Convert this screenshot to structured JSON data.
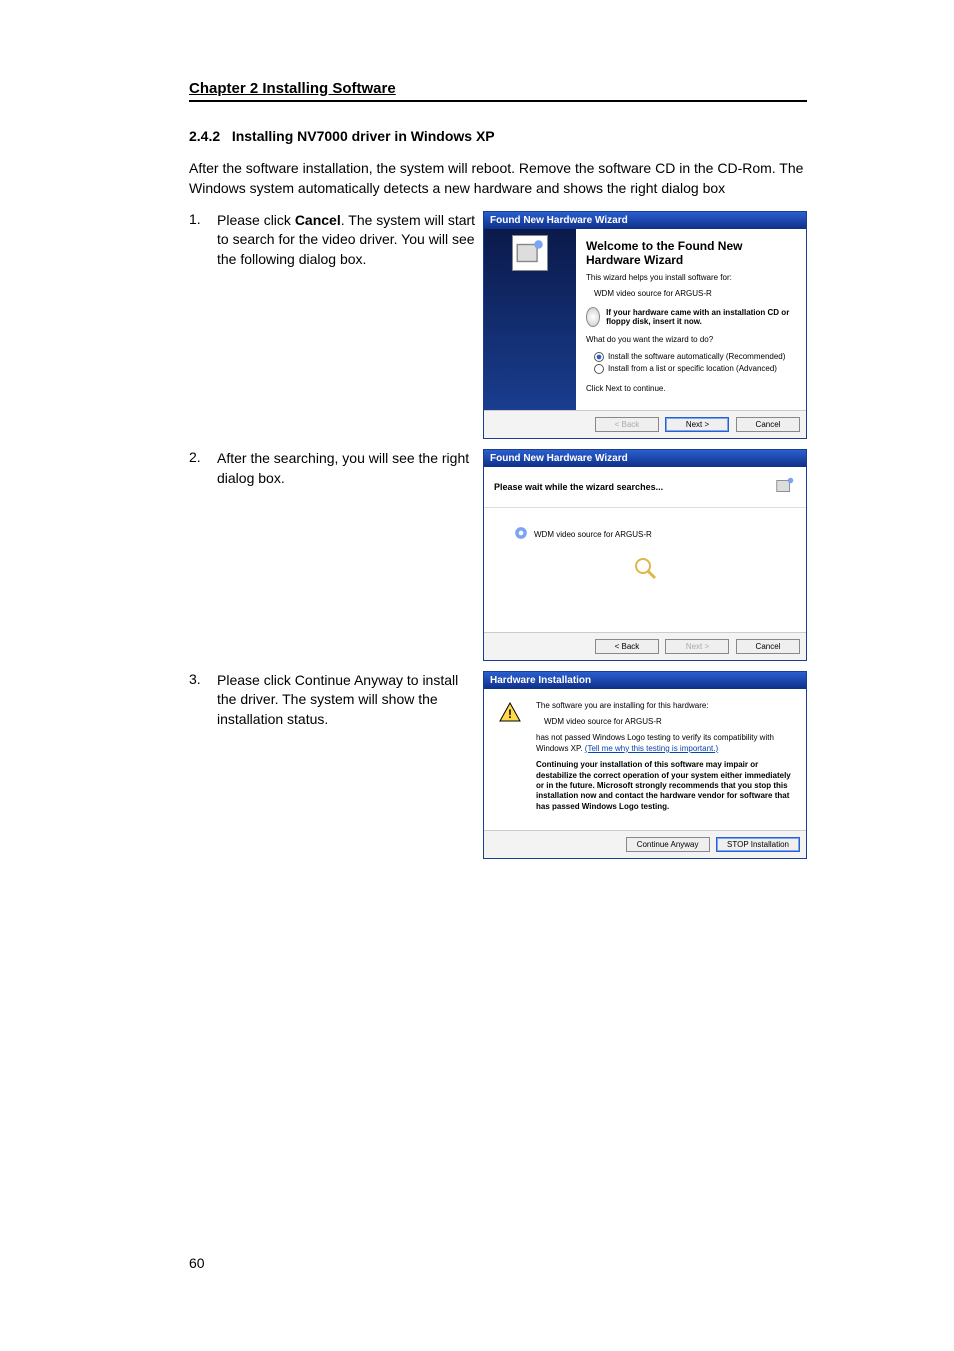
{
  "chapter_title": "Chapter 2 Installing Software",
  "section_number": "2.4.2",
  "section_title": "Installing NV7000 driver in Windows XP",
  "intro_text": "After the software installation, the system will reboot. Remove the software CD in the CD-Rom. The Windows system automatically detects a new hardware and shows the right dialog box",
  "steps": [
    {
      "num": "1.",
      "bold_word": "Cancel",
      "text": "The system will start to search for the video driver. You will see the following dialog box."
    },
    {
      "num": "2.",
      "text": "After the searching, you will see the right dialog box."
    },
    {
      "num": "3.",
      "text": "Please click Continue Anyway to install the driver. The system will show the installation status."
    }
  ],
  "dialog1": {
    "title": "Found New Hardware Wizard",
    "heading": "Welcome to the Found New Hardware Wizard",
    "subtext": "This wizard helps you install software for:",
    "device": "WDM video source for ARGUS-R",
    "cd_hint": "If your hardware came with an installation CD or floppy disk, insert it now.",
    "question": "What do you want the wizard to do?",
    "radio1": "Install the software automatically (Recommended)",
    "radio2": "Install from a list or specific location (Advanced)",
    "continue_hint": "Click Next to continue.",
    "back": "< Back",
    "next": "Next >",
    "cancel": "Cancel"
  },
  "dialog2": {
    "title": "Found New Hardware Wizard",
    "message": "Please wait while the wizard searches...",
    "device": "WDM video source for ARGUS-R",
    "back": "< Back",
    "next": "Next >",
    "cancel": "Cancel"
  },
  "dialog3": {
    "title": "Hardware Installation",
    "line1": "The software you are installing for this hardware:",
    "device": "WDM video source for ARGUS-R",
    "line2a": "has not passed Windows Logo testing to verify its compatibility with Windows XP.",
    "link": "(Tell me why this testing is important.)",
    "bold_text": "Continuing your installation of this software may impair or destabilize the correct operation of your system either immediately or in the future. Microsoft strongly recommends that you stop this installation now and contact the hardware vendor for software that has passed Windows Logo testing.",
    "continue": "Continue Anyway",
    "stop": "STOP Installation"
  },
  "page_number": "60"
}
